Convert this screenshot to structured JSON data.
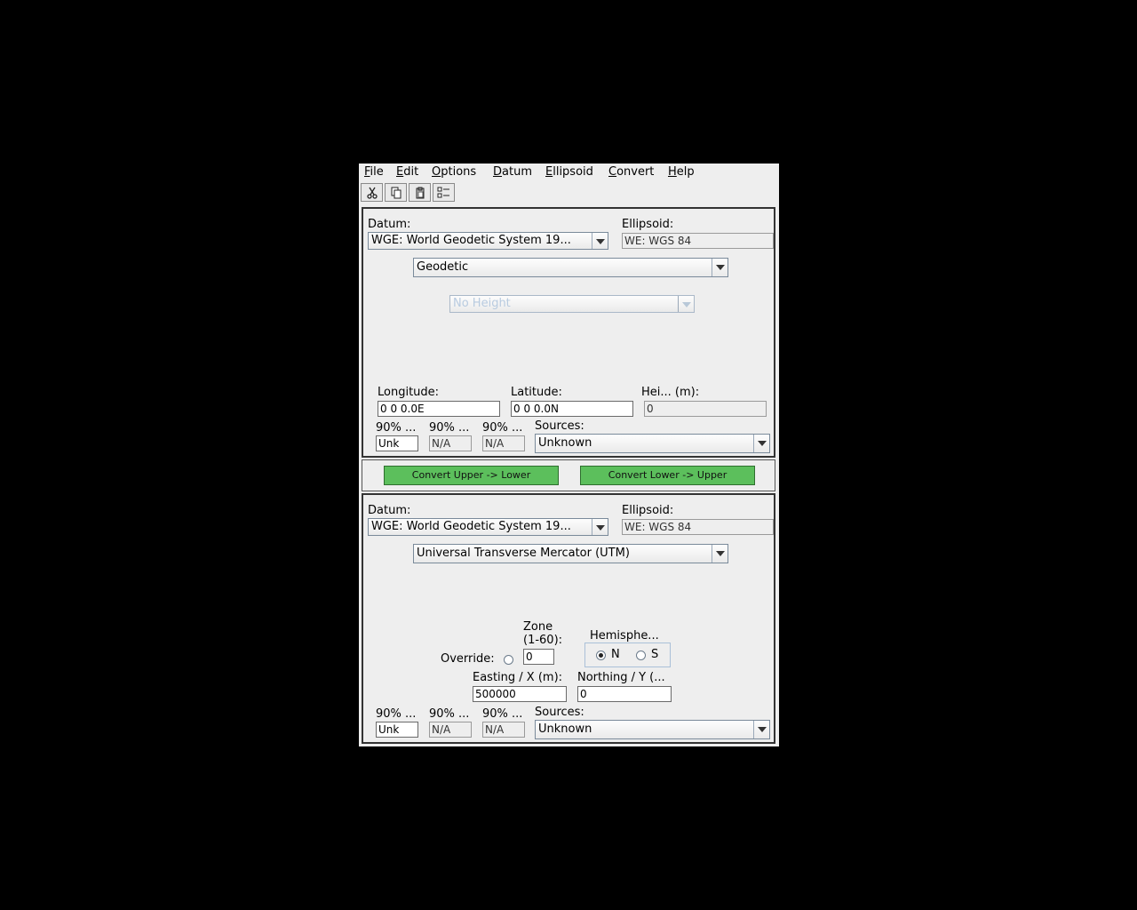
{
  "menu": [
    "File",
    "Edit",
    "Options",
    "Datum",
    "Ellipsoid",
    "Convert",
    "Help"
  ],
  "toolbar": {
    "icons": [
      "cut-icon",
      "copy-icon",
      "paste-icon",
      "properties-icon"
    ]
  },
  "upper": {
    "datum_label": "Datum:",
    "datum_value": "WGE:  World Geodetic System 19...",
    "ellipsoid_label": "Ellipsoid:",
    "ellipsoid_value": "WE:  WGS 84",
    "coord_type": "Geodetic",
    "height_type": "No Height",
    "longitude_label": "Longitude:",
    "longitude_value": "0 0 0.0E",
    "latitude_label": "Latitude:",
    "latitude_value": "0 0 0.0N",
    "height_label": "Hei... (m):",
    "height_value": "0",
    "acc1_label": "90% ...",
    "acc1_value": "Unk",
    "acc2_label": "90% ...",
    "acc2_value": "N/A",
    "acc3_label": "90% ...",
    "acc3_value": "N/A",
    "sources_label": "Sources:",
    "sources_value": "Unknown"
  },
  "convert": {
    "upper_to_lower": "Convert Upper -> Lower",
    "lower_to_upper": "Convert Lower -> Upper"
  },
  "lower": {
    "datum_label": "Datum:",
    "datum_value": "WGE:  World Geodetic System 19...",
    "ellipsoid_label": "Ellipsoid:",
    "ellipsoid_value": "WE:  WGS 84",
    "coord_type": "Universal Transverse Mercator (UTM)",
    "zone_label_1": "Zone",
    "zone_label_2": "(1-60):",
    "zone_value": "0",
    "override_label": "Override:",
    "hemisphere_label": "Hemisphe...",
    "hemi_n": "N",
    "hemi_s": "S",
    "easting_label": "Easting / X (m):",
    "easting_value": "500000",
    "northing_label": "Northing / Y (...",
    "northing_value": "0",
    "acc1_label": "90% ...",
    "acc1_value": "Unk",
    "acc2_label": "90% ...",
    "acc2_value": "N/A",
    "acc3_label": "90% ...",
    "acc3_value": "N/A",
    "sources_label": "Sources:",
    "sources_value": "Unknown"
  }
}
